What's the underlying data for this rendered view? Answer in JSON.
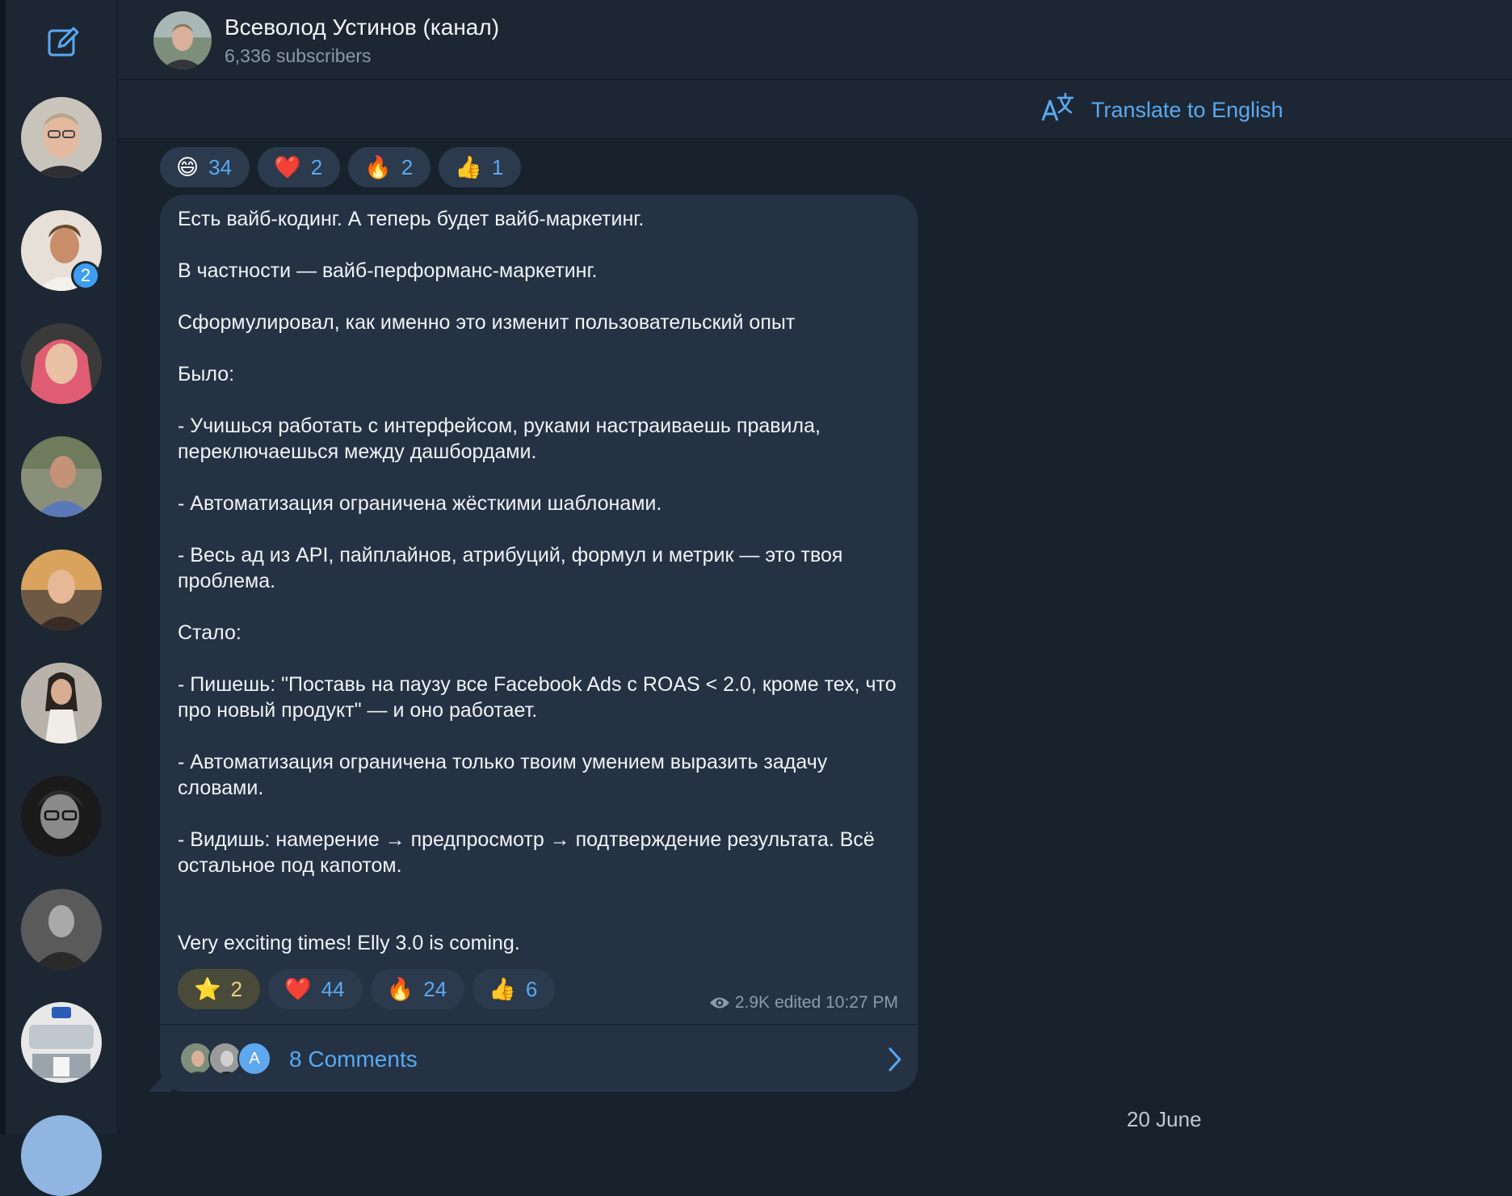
{
  "channel": {
    "title": "Всеволод Устинов (канал)",
    "subscribers": "6,336 subscribers"
  },
  "translate": {
    "label": "Translate to English"
  },
  "sidebar": {
    "compose_icon": "compose-icon",
    "chats": [
      {
        "name": "chat-avatar-1",
        "badge": ""
      },
      {
        "name": "chat-avatar-2",
        "badge": "2"
      },
      {
        "name": "chat-avatar-3",
        "badge": ""
      },
      {
        "name": "chat-avatar-4",
        "badge": ""
      },
      {
        "name": "chat-avatar-5",
        "badge": ""
      },
      {
        "name": "chat-avatar-6",
        "badge": ""
      },
      {
        "name": "chat-avatar-7",
        "badge": ""
      },
      {
        "name": "chat-avatar-8",
        "badge": ""
      },
      {
        "name": "chat-avatar-9",
        "badge": ""
      },
      {
        "name": "chat-avatar-10",
        "badge": ""
      }
    ]
  },
  "prev_reactions": [
    {
      "emoji": "😄",
      "count": "34"
    },
    {
      "emoji": "❤️",
      "count": "2"
    },
    {
      "emoji": "🔥",
      "count": "2"
    },
    {
      "emoji": "👍",
      "count": "1"
    }
  ],
  "post": {
    "paragraphs": [
      "Есть вайб-кодинг. А теперь будет вайб-маркетинг.",
      "В частности — вайб-перформанс-маркетинг.",
      "Сформулировал, как именно это изменит пользовательский опыт",
      "Было:",
      "- Учишься работать с интерфейсом, руками настраиваешь правила, переключаешься между дашбордами.",
      "- Автоматизация ограничена жёсткими шаблонами.",
      "- Весь ад из API, пайплайнов, атрибуций, формул и метрик — это твоя проблема.",
      "Стало:",
      "- Пишешь: \"Поставь на паузу все Facebook Ads с ROAS < 2.0, кроме тех, что про новый продукт\" — и оно работает.",
      "- Автоматизация ограничена только твоим умением выразить задачу словами.",
      "- Видишь: намерение → предпросмотр → подтверждение результата. Всё остальное под капотом."
    ],
    "closing": "Very exciting times! Elly 3.0 is coming.",
    "reactions": [
      {
        "emoji": "⭐",
        "count": "2"
      },
      {
        "emoji": "❤️",
        "count": "44"
      },
      {
        "emoji": "🔥",
        "count": "24"
      },
      {
        "emoji": "👍",
        "count": "6"
      }
    ],
    "views": "2.9K",
    "edited": "edited 10:27 PM",
    "comments_label": "8 Comments",
    "comment_avatar_letter": "A"
  },
  "date_divider": "20 June",
  "colors": {
    "accent": "#59a9f2",
    "bubble": "#243244",
    "background": "#18222d"
  }
}
